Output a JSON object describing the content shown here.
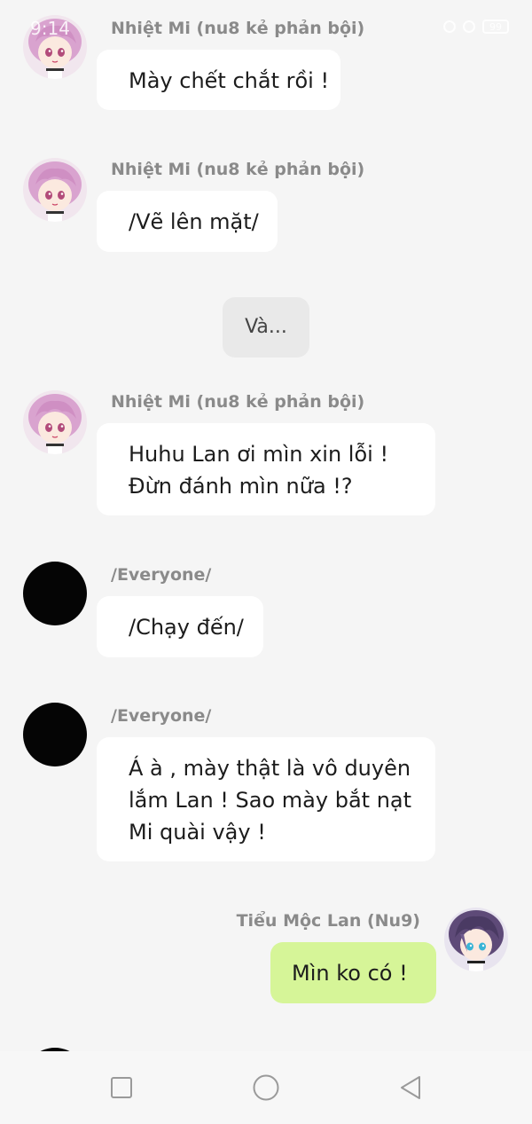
{
  "status_bar": {
    "time": "9:14",
    "battery": "99"
  },
  "messages": [
    {
      "sender": "Nhiệt Mi (nu8 kẻ phản bội)",
      "lines": [
        "Mày chết chắt rồi !"
      ]
    },
    {
      "sender": "Nhiệt Mi (nu8 kẻ phản bội)",
      "lines": [
        "/Vẽ lên mặt/"
      ]
    },
    {
      "narration": "Và..."
    },
    {
      "sender": "Nhiệt Mi (nu8 kẻ phản bội)",
      "lines": [
        "Huhu Lan ơi mìn xin lỗi !",
        "Đừn đánh mìn nữa !?"
      ]
    },
    {
      "sender": "/Everyone/",
      "lines": [
        "/Chạy đến/"
      ]
    },
    {
      "sender": "/Everyone/",
      "lines": [
        "Á à , mày thật là vô duyên",
        "lắm Lan ! Sao mày bắt nạt",
        "Mi quài vậy !"
      ]
    },
    {
      "sender": "Tiểu Mộc Lan (Nu9)",
      "lines": [
        "Mìn ko có !"
      ]
    }
  ],
  "avatars": {
    "nhiet_mi": "pink-hair-character-avatar",
    "everyone": "black-avatar",
    "tieu_moc_lan": "purple-hair-character-avatar"
  },
  "nav_bar": {
    "icons": [
      "square-recents-icon",
      "circle-home-icon",
      "triangle-back-icon"
    ]
  },
  "colors": {
    "background": "#f5f5f5",
    "bubble_left": "#ffffff",
    "bubble_right": "#d6f598",
    "sender_text": "#8a8a8a"
  }
}
